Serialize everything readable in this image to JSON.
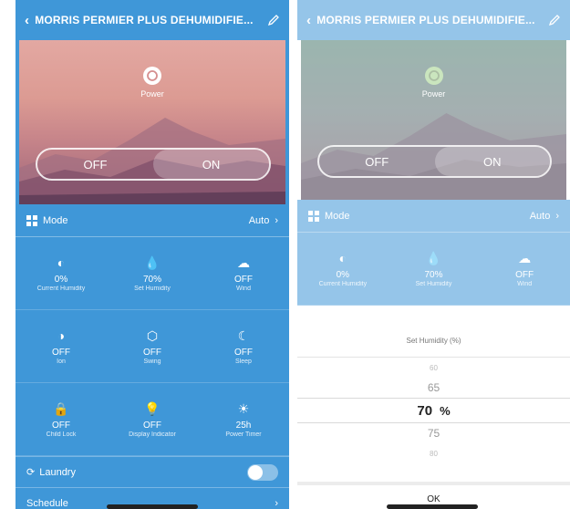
{
  "device_title": "MORRIS PERMIER PLUS DEHUMIDIFIE...",
  "power_label": "Power",
  "toggle": {
    "off": "OFF",
    "on": "ON"
  },
  "mode": {
    "label": "Mode",
    "value": "Auto"
  },
  "tiles": [
    {
      "icon": "current-humidity-icon",
      "value": "0%",
      "name": "Current Humidity"
    },
    {
      "icon": "set-humidity-icon",
      "value": "70%",
      "name": "Set Humidity"
    },
    {
      "icon": "speed-icon",
      "value": "OFF",
      "name": "Wind"
    },
    {
      "icon": "ion-icon",
      "value": "OFF",
      "name": "Ion"
    },
    {
      "icon": "swing-icon",
      "value": "OFF",
      "name": "Swing"
    },
    {
      "icon": "sleep-icon",
      "value": "OFF",
      "name": "Sleep"
    },
    {
      "icon": "child-lock-icon",
      "value": "OFF",
      "name": "Child Lock"
    },
    {
      "icon": "bulb-icon",
      "value": "OFF",
      "name": "Display Indicator"
    },
    {
      "icon": "timer-icon",
      "value": "25h",
      "name": "Power Timer"
    }
  ],
  "laundry": {
    "label": "Laundry"
  },
  "schedule": {
    "label": "Schedule"
  },
  "picker": {
    "title": "Set Humidity (%)",
    "options_above": [
      "60",
      "65"
    ],
    "selected": "70",
    "unit": "%",
    "options_below": [
      "75",
      "80"
    ],
    "ok": "OK"
  },
  "colors": {
    "accent": "#3f97d8"
  }
}
